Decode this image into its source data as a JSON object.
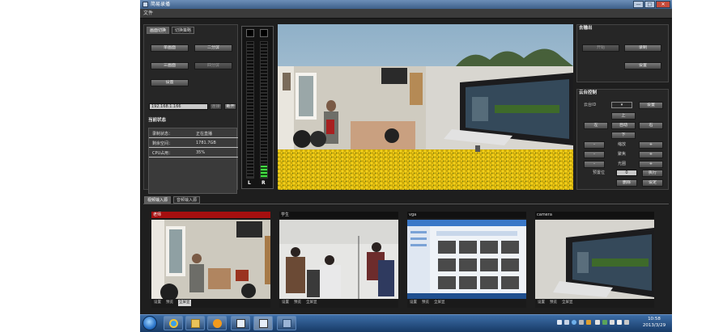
{
  "window": {
    "title": "简易录播",
    "controls": [
      "—",
      "□",
      "✕"
    ]
  },
  "menu": {
    "file": "文件"
  },
  "left_panel": {
    "tabs": [
      "画面切换",
      "切换策略"
    ],
    "buttons": [
      "单画面",
      "二分屏",
      "三画面",
      "四分屏",
      "设置"
    ],
    "ip_value": "192.168.1.166",
    "ip_buttons": [
      "连接",
      "断开"
    ],
    "status_title": "当前状态",
    "status_rows": [
      {
        "key": "录制状态：",
        "value": "正在直播"
      },
      {
        "key": "剩余空间：",
        "value": "1781.7GB"
      },
      {
        "key": "CPU占用：",
        "value": "35%"
      }
    ]
  },
  "vu_meter": {
    "left_label": "L",
    "right_label": "R",
    "left_level": 0.0,
    "right_level": 0.09
  },
  "right_panel": {
    "output_title": "去输出",
    "output_buttons": [
      "开始",
      "录制",
      "设置"
    ],
    "ptz_title": "云台控制",
    "ptz_select_label": "云台ID",
    "ptz_set": "设置",
    "direction_buttons": [
      "上",
      "左",
      "自动",
      "右",
      "下"
    ],
    "zoom_rows": [
      {
        "minus": "-",
        "label": "缩放",
        "plus": "+"
      },
      {
        "minus": "-",
        "label": "聚焦",
        "plus": "+"
      },
      {
        "minus": "-",
        "label": "光圈",
        "plus": "+"
      }
    ],
    "preset_label": "预置位",
    "preset_value": "0",
    "preset_buttons": [
      "执行",
      "删除",
      "设定"
    ]
  },
  "bottom": {
    "tabs": [
      "视频输入源",
      "音频输入源"
    ],
    "thumbs": [
      {
        "title": "老师",
        "controls": [
          "设置",
          "预览",
          "全屏显"
        ]
      },
      {
        "title": "学生",
        "controls": [
          "设置",
          "预览",
          "全屏显"
        ]
      },
      {
        "title": "vga",
        "controls": [
          "设置",
          "预览",
          "全屏显"
        ]
      },
      {
        "title": "camera",
        "controls": [
          "设置",
          "预览",
          "全屏显"
        ]
      }
    ]
  },
  "taskbar": {
    "time": "10:58",
    "date": "2013/3/29",
    "apps": [
      "ie-icon",
      "folder-icon",
      "media-player-icon",
      "window-icon",
      "window-icon",
      "app-icon"
    ]
  },
  "colors": {
    "accent_red": "#a50f0f",
    "meter_green": "#45e045",
    "titlebar": "#3d5f8a"
  }
}
